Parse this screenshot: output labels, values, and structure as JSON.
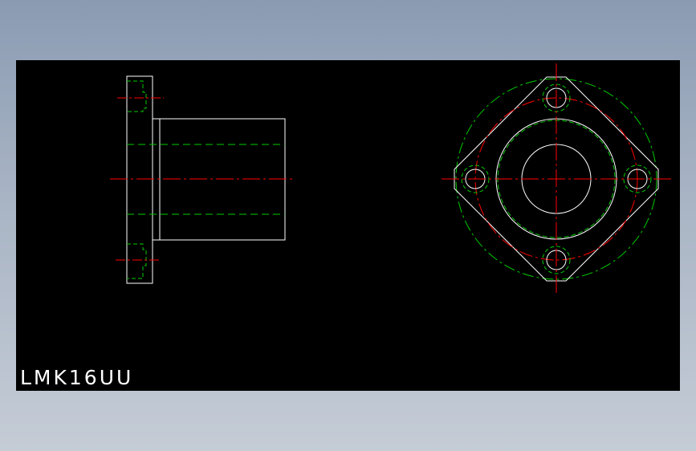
{
  "drawing": {
    "part_label": "LMK16UU",
    "colors": {
      "background": "#000000",
      "outline": "#ffffff",
      "center_line": "#ff0000",
      "hidden_line": "#00cc00",
      "page": "#9aa8bb"
    }
  }
}
